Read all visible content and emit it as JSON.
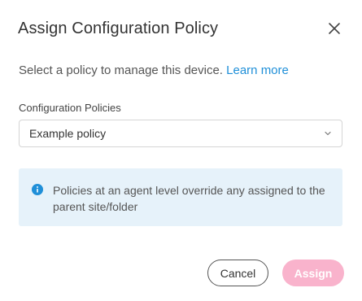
{
  "dialog": {
    "title": "Assign Configuration Policy",
    "description": "Select a policy to manage this device.",
    "learn_more": "Learn more",
    "field_label": "Configuration Policies",
    "selected_policy": "Example policy",
    "info_text": "Policies at an agent level override any assigned to the parent site/folder",
    "cancel_label": "Cancel",
    "assign_label": "Assign"
  },
  "icons": {
    "close": "close-icon",
    "dropdown": "chevron-down-icon",
    "info": "info-icon"
  },
  "colors": {
    "link": "#1f8fd8",
    "info_background": "#e6f2fa",
    "info_icon": "#1f8fd8",
    "assign_button_disabled": "#f9b3cc"
  }
}
